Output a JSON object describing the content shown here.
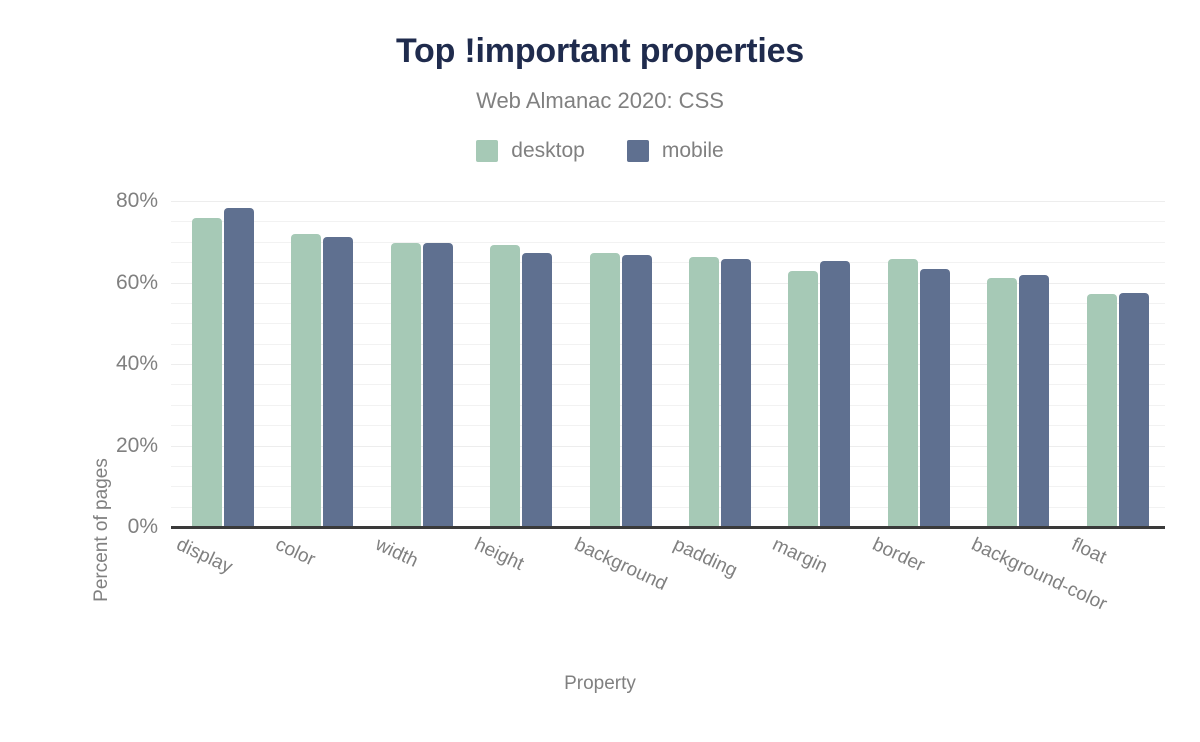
{
  "chart_data": {
    "type": "bar",
    "title": "Top !important properties",
    "subtitle": "Web Almanac 2020: CSS",
    "xlabel": "Property",
    "ylabel": "Percent of pages",
    "ylim": [
      0,
      80
    ],
    "ytick_labels": [
      "0%",
      "20%",
      "40%",
      "60%",
      "80%"
    ],
    "ytick_values": [
      0,
      20,
      40,
      60,
      80
    ],
    "minor_gridline_step": 5,
    "grid": true,
    "legend_position": "top-center",
    "categories": [
      "display",
      "color",
      "width",
      "height",
      "background",
      "padding",
      "margin",
      "border",
      "background-color",
      "float"
    ],
    "series": [
      {
        "name": "desktop",
        "color": "#a6c9b6",
        "values": [
          75.9,
          72.0,
          69.6,
          69.2,
          67.3,
          66.3,
          62.9,
          65.8,
          61.0,
          57.2
        ]
      },
      {
        "name": "mobile",
        "color": "#5f7090",
        "values": [
          78.3,
          71.2,
          69.6,
          67.3,
          66.7,
          65.7,
          65.3,
          63.3,
          61.8,
          57.5
        ]
      }
    ]
  },
  "legend": {
    "items": [
      {
        "label": "desktop",
        "color": "#a6c9b6"
      },
      {
        "label": "mobile",
        "color": "#5f7090"
      }
    ]
  },
  "colors": {
    "title": "#1f2b4d",
    "text_muted": "#808080",
    "axis": "#3a3a3a",
    "gridline": "#f2f2f2",
    "background": "#ffffff",
    "desktop": "#a6c9b6",
    "mobile": "#5f7090"
  }
}
